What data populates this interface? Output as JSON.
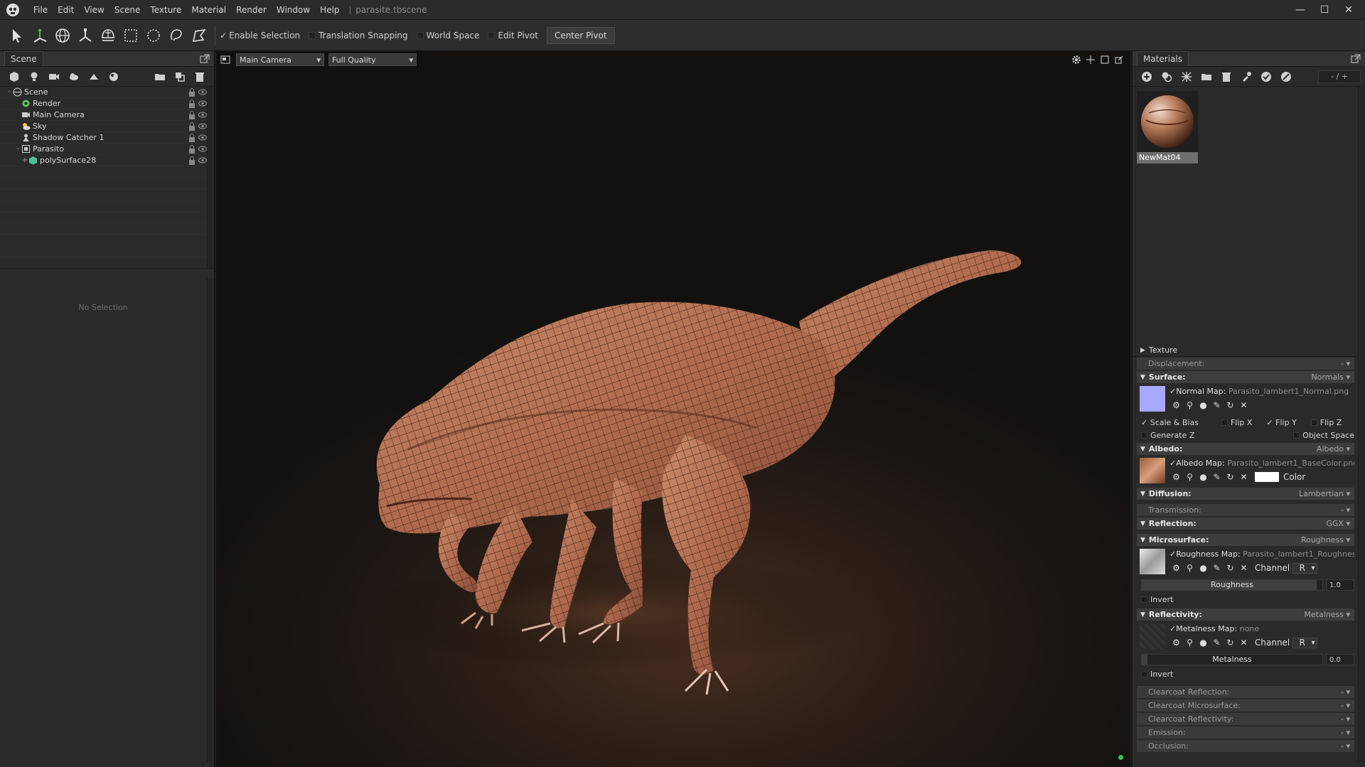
{
  "app": {
    "document_title": "parasite.tbscene",
    "menu": [
      "File",
      "Edit",
      "View",
      "Scene",
      "Texture",
      "Material",
      "Render",
      "Window",
      "Help"
    ]
  },
  "toolbar": {
    "enable_selection": "Enable Selection",
    "translation_snapping": "Translation Snapping",
    "world_space": "World Space",
    "edit_pivot": "Edit Pivot",
    "center_pivot": "Center Pivot"
  },
  "scene_panel": {
    "tab": "Scene",
    "tree": [
      {
        "label": "Scene",
        "icon": "scene-icon",
        "depth": 0,
        "expander": "-"
      },
      {
        "label": "Render",
        "icon": "render-icon",
        "depth": 1,
        "expander": ""
      },
      {
        "label": "Main Camera",
        "icon": "camera-icon",
        "depth": 1,
        "expander": ""
      },
      {
        "label": "Sky",
        "icon": "sky-icon",
        "depth": 1,
        "expander": ""
      },
      {
        "label": "Shadow Catcher 1",
        "icon": "shadow-catcher-icon",
        "depth": 1,
        "expander": ""
      },
      {
        "label": "Parasito",
        "icon": "object-icon",
        "depth": 1,
        "expander": "-"
      },
      {
        "label": "polySurface28",
        "icon": "mesh-icon",
        "depth": 2,
        "expander": "+"
      }
    ],
    "no_selection": "No Selection"
  },
  "viewport": {
    "camera": "Main Camera",
    "quality": "Full Quality"
  },
  "materials_panel": {
    "tab": "Materials",
    "counter": "- / +",
    "materials": [
      {
        "name": "NewMat04"
      }
    ],
    "sections": {
      "texture": "Texture",
      "displacement": "Displacement:",
      "displacement_value": "-",
      "surface": "Surface:",
      "surface_value": "Normals",
      "normal_map_label": "Normal Map:",
      "normal_map_file": "Parasito_lambert1_Normal.png",
      "scale_bias": "Scale & Bias",
      "flip_x": "Flip X",
      "flip_y": "Flip Y",
      "flip_z": "Flip Z",
      "generate_z": "Generate Z",
      "object_space": "Object Space",
      "albedo": "Albedo:",
      "albedo_value": "Albedo",
      "albedo_map_label": "Albedo Map:",
      "albedo_map_file": "Parasito_lambert1_BaseColor.png",
      "color": "Color",
      "diffusion": "Diffusion:",
      "diffusion_value": "Lambertian",
      "transmission": "Transmission:",
      "transmission_value": "-",
      "reflection": "Reflection:",
      "reflection_value": "GGX",
      "microsurface": "Microsurface:",
      "microsurface_value": "Roughness",
      "roughness_map_label": "Roughness Map:",
      "roughness_map_file": "Parasito_lambert1_Roughnes",
      "channel": "Channel",
      "roughness_channel": "R",
      "roughness": "Roughness",
      "roughness_value": "1.0",
      "invert": "Invert",
      "reflectivity": "Reflectivity:",
      "reflectivity_value": "Metalness",
      "metalness_map_label": "Metalness Map:",
      "metalness_map_file": "none",
      "metalness_channel": "R",
      "metalness": "Metalness",
      "metalness_value": "0.0",
      "clearcoat_reflection": "Clearcoat Reflection:",
      "clearcoat_microsurface": "Clearcoat Microsurface:",
      "clearcoat_reflectivity": "Clearcoat Reflectivity:",
      "emission": "Emission:",
      "occlusion": "Occlusion:",
      "dash": "-"
    }
  },
  "colors": {
    "accent_green": "#37c54b",
    "normal_swatch": "#a8a8ff",
    "panel_bg": "#2a2a2a"
  }
}
